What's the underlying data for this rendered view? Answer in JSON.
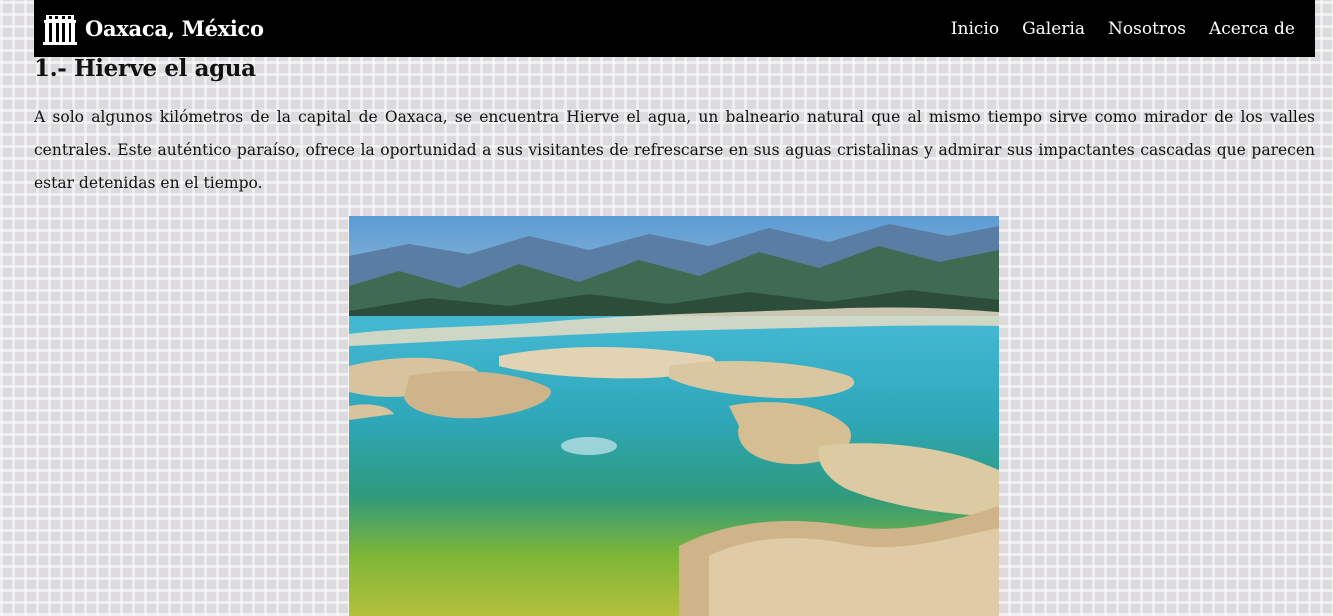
{
  "navbar": {
    "brand": "Oaxaca, México",
    "brand_icon": "temple-icon",
    "links": [
      "Inicio",
      "Galeria",
      "Nosotros",
      "Acerca de"
    ]
  },
  "article": {
    "title": "1.- Hierve el agua",
    "paragraph": "A solo algunos kilómetros de la capital de Oaxaca, se encuentra Hierve el agua, un balneario natural que al mismo tiempo sirve como mirador de los valles centrales. Este auténtico paraíso, ofrece la oportunidad a sus visitantes de refrescarse en sus aguas cristalinas y admirar sus impactantes cascadas que parecen estar detenidas en el tiempo."
  }
}
